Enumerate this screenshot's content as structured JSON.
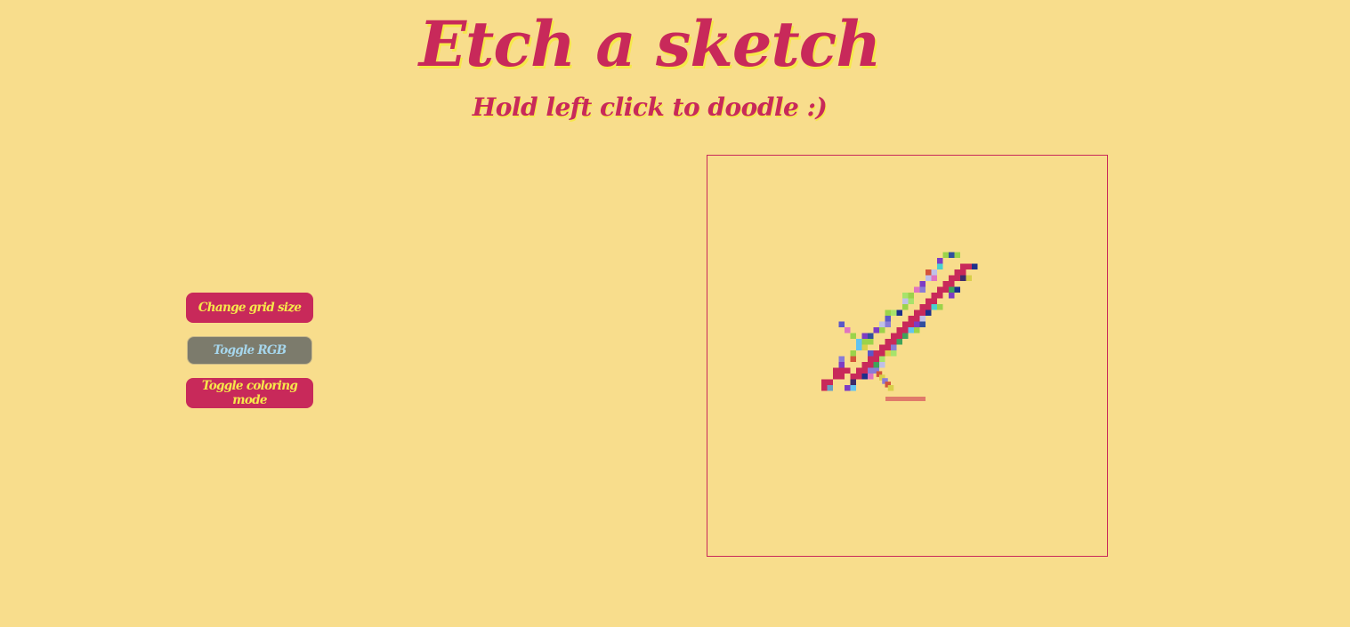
{
  "header": {
    "title": "Etch a sketch",
    "subtitle": "Hold left click to doodle :)"
  },
  "controls": {
    "grid_size_label": "Change grid size",
    "rgb_label": "Toggle RGB",
    "coloring_mode_label": "Toggle coloring mode"
  },
  "colors": {
    "background": "#f8dd8c",
    "accent": "#c8295a",
    "highlight": "#f6e84a",
    "disabled_button": "#7c7b6c"
  }
}
